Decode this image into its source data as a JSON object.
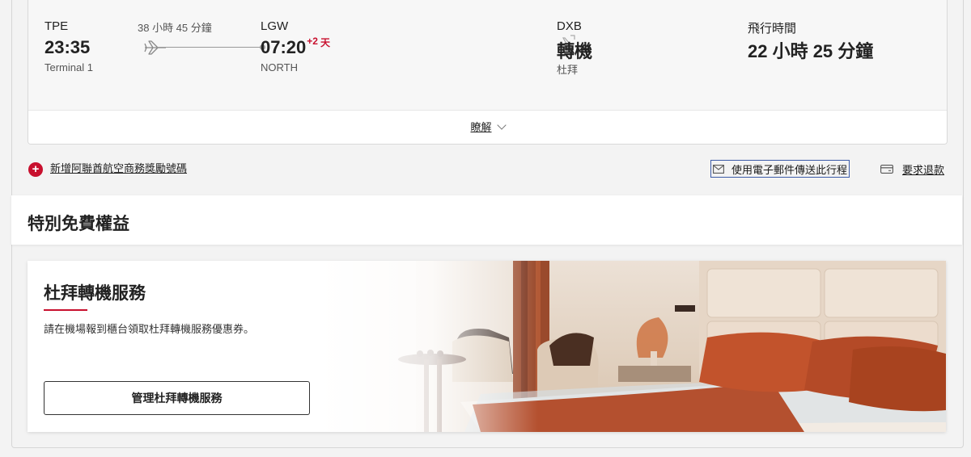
{
  "flight": {
    "origin_code": "TPE",
    "origin_time": "23:35",
    "origin_terminal": "Terminal 1",
    "duration_segment": "38 小時 45 分鐘",
    "dest_code": "LGW",
    "dest_time": "07:20",
    "dest_plus": "+2",
    "dest_plus_suffix": "天",
    "dest_terminal": "NORTH",
    "transfer_code": "DXB",
    "transfer_label": "轉機",
    "transfer_city": "杜拜",
    "flight_time_label": "飛行時間",
    "flight_time_value": "22 小時 25 分鐘",
    "details_link": "瞭解"
  },
  "actions": {
    "add_skywards": "新增阿聯酋航空商務獎勵號碼",
    "email_itinerary": "使用電子郵件傳送此行程",
    "request_refund": "要求退款"
  },
  "benefits": {
    "title": "特別免費權益"
  },
  "service": {
    "title": "杜拜轉機服務",
    "description": "請在機場報到櫃台領取杜拜轉機服務優惠券。",
    "button": "管理杜拜轉機服務"
  },
  "colors": {
    "brand_red": "#c8102e",
    "focus_blue": "#3c5ba8"
  }
}
